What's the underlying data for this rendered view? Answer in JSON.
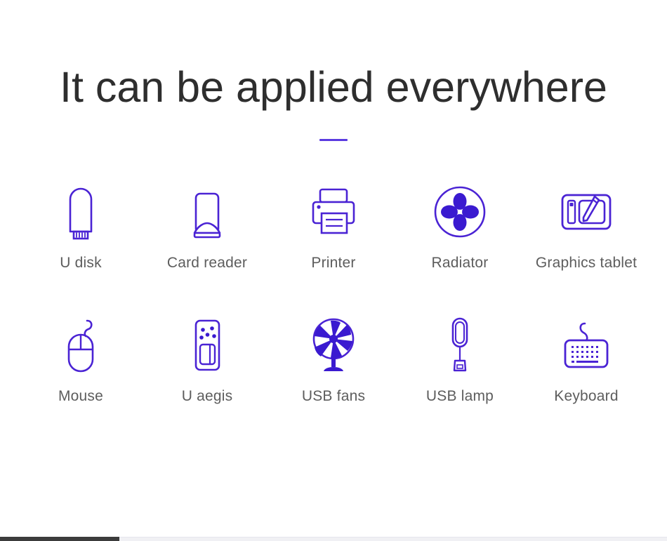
{
  "header": {
    "title": "It can be applied everywhere",
    "divider_color": "#5b3be0"
  },
  "theme": {
    "accent_color": "#4a23d4",
    "title_color": "#2e2e2e",
    "label_color": "#5d5d5d",
    "background_color": "#ffffff"
  },
  "grid": {
    "rows": [
      {
        "items": [
          {
            "label": "U disk",
            "icon": "usb-flash-drive-icon"
          },
          {
            "label": "Card reader",
            "icon": "card-reader-icon"
          },
          {
            "label": "Printer",
            "icon": "printer-icon"
          },
          {
            "label": "Radiator",
            "icon": "radiator-fan-icon"
          },
          {
            "label": "Graphics tablet",
            "icon": "graphics-tablet-icon"
          }
        ]
      },
      {
        "items": [
          {
            "label": "Mouse",
            "icon": "mouse-icon"
          },
          {
            "label": "U aegis",
            "icon": "u-aegis-icon"
          },
          {
            "label": "USB fans",
            "icon": "desk-fan-icon"
          },
          {
            "label": "USB lamp",
            "icon": "usb-lamp-icon"
          },
          {
            "label": "Keyboard",
            "icon": "keyboard-icon"
          }
        ]
      }
    ]
  },
  "scrollbar": {
    "orientation": "horizontal",
    "thumb_color": "#3c3c3c",
    "track_color": "#f0f0f4"
  }
}
